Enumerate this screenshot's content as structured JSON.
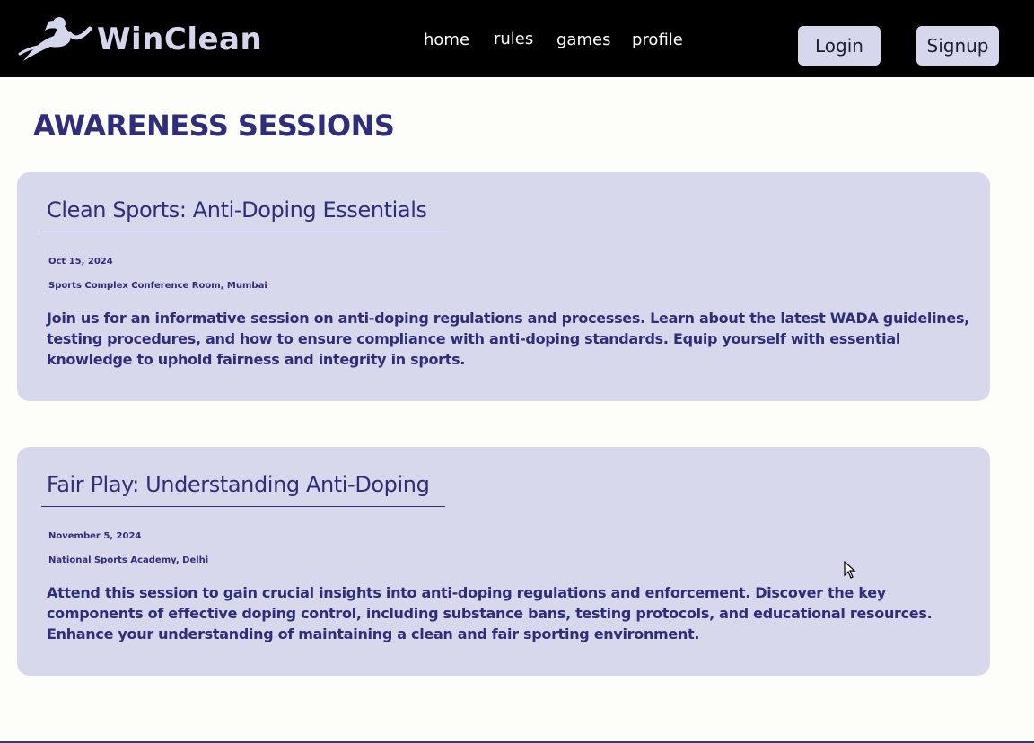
{
  "header": {
    "logo_text": "WinClean",
    "nav": [
      "home",
      "rules",
      "games",
      "profile"
    ],
    "login_label": "Login",
    "signup_label": "Signup"
  },
  "page": {
    "title": "AWARENESS SESSIONS"
  },
  "sessions": [
    {
      "title": "Clean Sports: Anti-Doping Essentials",
      "date": "Oct 15, 2024",
      "location": "Sports Complex Conference Room, Mumbai",
      "description": "Join us for an informative session on anti-doping regulations and processes. Learn about the latest WADA guidelines, testing procedures, and how to ensure compliance with anti-doping standards. Equip yourself with essential knowledge to uphold fairness and integrity in sports."
    },
    {
      "title": "Fair Play: Understanding Anti-Doping",
      "date": "November 5, 2024",
      "location": "National Sports Academy, Delhi",
      "description": "Attend this session to gain crucial insights into anti-doping regulations and enforcement. Discover the key components of effective doping control, including substance bans, testing protocols, and educational resources. Enhance your understanding of maintaining a clean and fair sporting environment."
    }
  ],
  "icons": {
    "logo": "runner-icon",
    "cursor": "mouse-pointer-icon"
  },
  "colors": {
    "accent": "#2e2e7a",
    "card_bg": "#d7d8ec",
    "nav_bg": "#000000"
  }
}
